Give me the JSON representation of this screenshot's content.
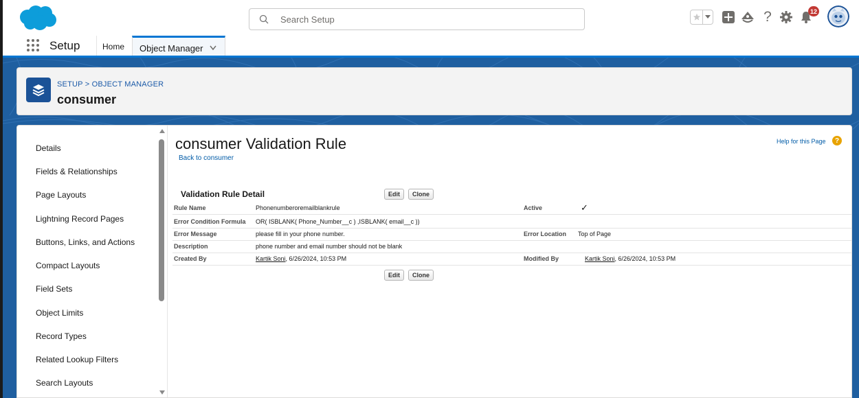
{
  "header": {
    "search_placeholder": "Search Setup",
    "notification_count": "12"
  },
  "nav": {
    "app_name": "Setup",
    "tabs": [
      {
        "label": "Home"
      },
      {
        "label": "Object Manager"
      }
    ]
  },
  "object_header": {
    "breadcrumb": "SETUP > OBJECT MANAGER",
    "title": "consumer"
  },
  "sidebar": {
    "items": [
      {
        "label": "Details"
      },
      {
        "label": "Fields & Relationships"
      },
      {
        "label": "Page Layouts"
      },
      {
        "label": "Lightning Record Pages"
      },
      {
        "label": "Buttons, Links, and Actions"
      },
      {
        "label": "Compact Layouts"
      },
      {
        "label": "Field Sets"
      },
      {
        "label": "Object Limits"
      },
      {
        "label": "Record Types"
      },
      {
        "label": "Related Lookup Filters"
      },
      {
        "label": "Search Layouts"
      }
    ]
  },
  "main": {
    "page_title": "consumer Validation Rule",
    "back_link": "Back to consumer",
    "help_link": "Help for this Page",
    "section_title": "Validation Rule Detail",
    "edit_label": "Edit",
    "clone_label": "Clone",
    "fields": {
      "rule_name_label": "Rule Name",
      "rule_name_value": "Phonenumberoremailblankrule",
      "active_label": "Active",
      "active_value": "✓",
      "error_condition_label": "Error Condition Formula",
      "error_condition_value": "OR( ISBLANK( Phone_Number__c ) ,ISBLANK( email__c ))",
      "error_message_label": "Error Message",
      "error_message_value": "please fill in your phone number.",
      "error_location_label": "Error Location",
      "error_location_value": "Top of Page",
      "description_label": "Description",
      "description_value": "phone number and email number should not be blank",
      "created_by_label": "Created By",
      "created_by_user": "Kartik Soni",
      "created_by_date": ", 6/26/2024, 10:53 PM",
      "modified_by_label": "Modified By",
      "modified_by_user": "Kartik Soni",
      "modified_by_date": ", 6/26/2024, 10:53 PM"
    }
  }
}
